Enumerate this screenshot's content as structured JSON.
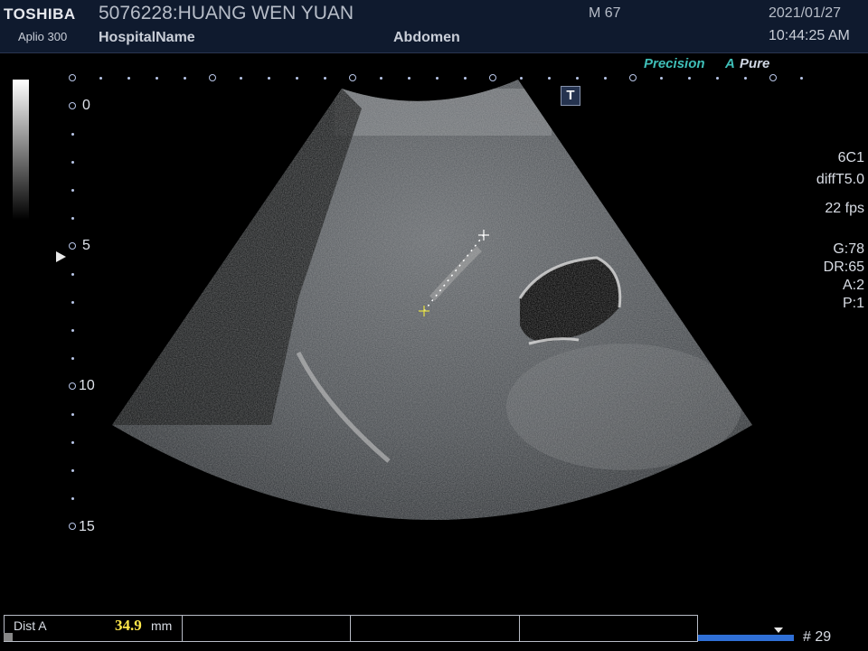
{
  "header": {
    "brand": "TOSHIBA",
    "model": "Aplio 300",
    "patient": "5076228:HUANG WEN YUAN",
    "hospital": "HospitalName",
    "sex_age": "M 67",
    "exam": "Abdomen",
    "date": "2021/01/27",
    "time": "10:44:25 AM"
  },
  "overlay": {
    "precision": "Precision",
    "apure_a": "A",
    "apure_rest": "Pure",
    "thi_mark": "T"
  },
  "depth_scale": {
    "labels": [
      "0",
      "5",
      "10",
      "15"
    ]
  },
  "parameters": {
    "probe": "6C1",
    "mode": "diffT5.0",
    "frame_rate": "22 fps",
    "gain": "G:78",
    "dynamic_range": "DR:65",
    "a_value": "A:2",
    "p_value": "P:1"
  },
  "measurement": {
    "label": "Dist A",
    "value": "34.9",
    "unit": "mm"
  },
  "cine": {
    "frame_label": "# 29"
  },
  "colors": {
    "header_bg": "#0f1a2e",
    "measure_value": "#ffe84a",
    "accent_teal": "#3fbfb8",
    "cine_bar": "#2f6fd6"
  }
}
